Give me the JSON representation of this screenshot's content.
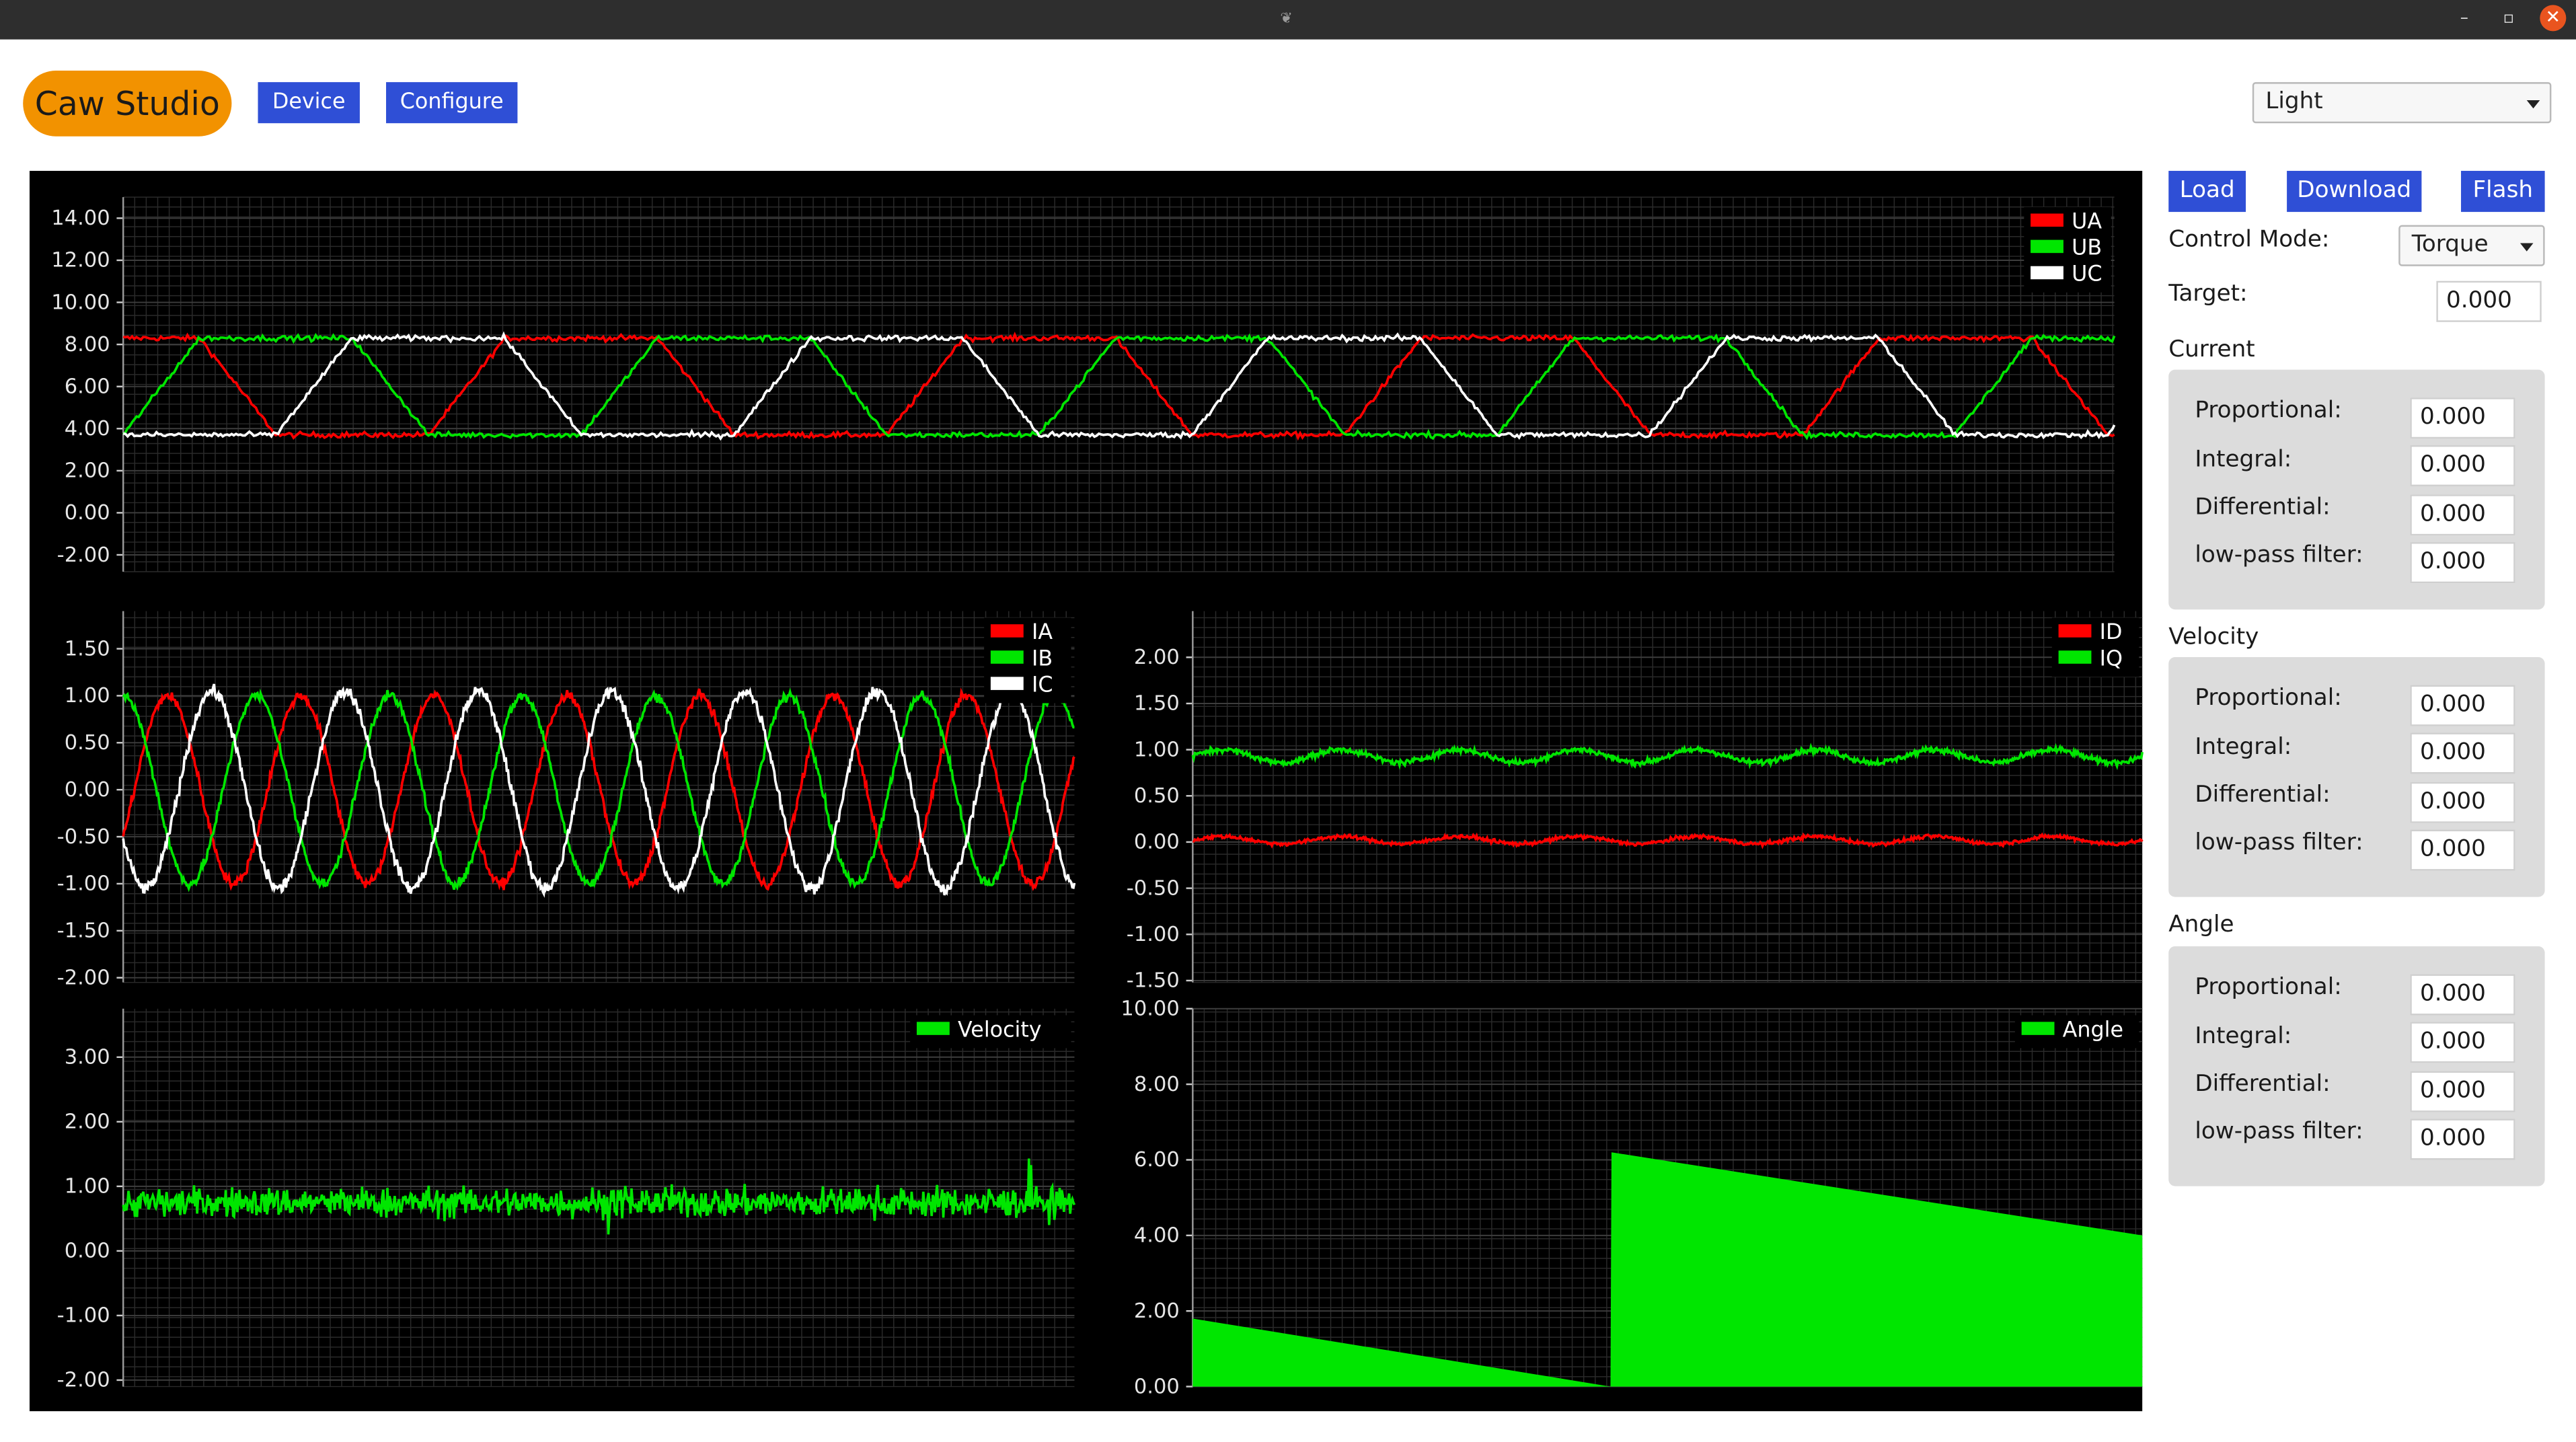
{
  "header": {
    "app_name": "Caw Studio",
    "device_label": "Device",
    "configure_label": "Configure",
    "theme_value": "Light"
  },
  "sidebar": {
    "load_label": "Load",
    "download_label": "Download",
    "flash_label": "Flash",
    "control_mode_label": "Control Mode:",
    "control_mode_value": "Torque",
    "target_label": "Target:",
    "target_value": "0.000",
    "groups": [
      {
        "title": "Current",
        "rows": [
          {
            "label": "Proportional:",
            "value": "0.000"
          },
          {
            "label": "Integral:",
            "value": "0.000"
          },
          {
            "label": "Differential:",
            "value": "0.000"
          },
          {
            "label": "low-pass filter:",
            "value": "0.000"
          }
        ]
      },
      {
        "title": "Velocity",
        "rows": [
          {
            "label": "Proportional:",
            "value": "0.000"
          },
          {
            "label": "Integral:",
            "value": "0.000"
          },
          {
            "label": "Differential:",
            "value": "0.000"
          },
          {
            "label": "low-pass filter:",
            "value": "0.000"
          }
        ]
      },
      {
        "title": "Angle",
        "rows": [
          {
            "label": "Proportional:",
            "value": "0.000"
          },
          {
            "label": "Integral:",
            "value": "0.000"
          },
          {
            "label": "Differential:",
            "value": "0.000"
          },
          {
            "label": "low-pass filter:",
            "value": "0.000"
          }
        ]
      }
    ]
  },
  "colors": {
    "red": "#ff0000",
    "green": "#00e600",
    "white": "#ffffff",
    "accent": "#2f4fd6",
    "logo": "#f29200"
  },
  "chart_data": [
    {
      "type": "line",
      "id": "voltage",
      "ylim": [
        -2.8,
        15
      ],
      "yticks": [
        "14.00",
        "12.00",
        "10.00",
        "8.00",
        "6.00",
        "4.00",
        "2.00",
        "0.00",
        "-2.00"
      ],
      "ytick_values": [
        14,
        12,
        10,
        8,
        6,
        4,
        2,
        0,
        -2
      ],
      "legend": [
        "UA",
        "UB",
        "UC"
      ],
      "legend_position": "top-right",
      "series": [
        {
          "name": "UA",
          "color": "#ff0000",
          "shape": "trapezoid",
          "low": 3.7,
          "high": 8.3,
          "period_fraction": 0.23,
          "phase": 0.333,
          "noise": 0.12
        },
        {
          "name": "UB",
          "color": "#00e600",
          "shape": "trapezoid",
          "low": 3.7,
          "high": 8.3,
          "period_fraction": 0.23,
          "phase": 0.0,
          "noise": 0.12
        },
        {
          "name": "UC",
          "color": "#ffffff",
          "shape": "trapezoid",
          "low": 3.7,
          "high": 8.3,
          "period_fraction": 0.23,
          "phase": 0.667,
          "noise": 0.12
        }
      ],
      "grid": true
    },
    {
      "type": "line",
      "id": "phase-current",
      "ylim": [
        -2.05,
        1.9
      ],
      "yticks": [
        "1.50",
        "1.00",
        "0.50",
        "0.00",
        "-0.50",
        "-1.00",
        "-1.50",
        "-2.00"
      ],
      "ytick_values": [
        1.5,
        1.0,
        0.5,
        0,
        -0.5,
        -1.0,
        -1.5,
        -2.0
      ],
      "legend": [
        "IA",
        "IB",
        "IC"
      ],
      "legend_position": "top-right",
      "series": [
        {
          "name": "IA",
          "color": "#ff0000",
          "shape": "sine",
          "amplitude": 1.0,
          "period_fraction": 0.14,
          "phase": 0.333,
          "noise": 0.05
        },
        {
          "name": "IB",
          "color": "#00e600",
          "shape": "sine",
          "amplitude": 1.0,
          "period_fraction": 0.14,
          "phase": 0.0,
          "noise": 0.05
        },
        {
          "name": "IC",
          "color": "#ffffff",
          "shape": "sine",
          "amplitude": 1.05,
          "period_fraction": 0.14,
          "phase": 0.667,
          "noise": 0.06
        }
      ],
      "grid": true
    },
    {
      "type": "line",
      "id": "dq-current",
      "ylim": [
        -1.52,
        2.5
      ],
      "yticks": [
        "2.00",
        "1.50",
        "1.00",
        "0.50",
        "0.00",
        "-0.50",
        "-1.00",
        "-1.50"
      ],
      "ytick_values": [
        2.0,
        1.5,
        1.0,
        0.5,
        0,
        -0.5,
        -1.0,
        -1.5
      ],
      "legend": [
        "ID",
        "IQ"
      ],
      "legend_position": "top-right",
      "series": [
        {
          "name": "ID",
          "color": "#ff0000",
          "shape": "flat",
          "level": 0.02,
          "wobble": 0.04,
          "noise": 0.02
        },
        {
          "name": "IQ",
          "color": "#00e600",
          "shape": "flat",
          "level": 0.93,
          "wobble": 0.07,
          "noise": 0.03
        }
      ],
      "grid": true
    },
    {
      "type": "line",
      "id": "velocity",
      "ylim": [
        -2.1,
        3.75
      ],
      "yticks": [
        "3.00",
        "2.00",
        "1.00",
        "0.00",
        "-1.00",
        "-2.00"
      ],
      "ytick_values": [
        3.0,
        2.0,
        1.0,
        0,
        -1.0,
        -2.0
      ],
      "legend": [
        "Velocity"
      ],
      "legend_position": "top-right",
      "series": [
        {
          "name": "Velocity",
          "color": "#00e600",
          "shape": "noise",
          "level": 0.75,
          "noise": 0.22
        }
      ],
      "grid": true
    },
    {
      "type": "area",
      "id": "angle",
      "ylim": [
        0,
        10
      ],
      "yticks": [
        "10.00",
        "8.00",
        "6.00",
        "4.00",
        "2.00",
        "0.00"
      ],
      "ytick_values": [
        10,
        8,
        6,
        4,
        2,
        0
      ],
      "legend": [
        "Angle"
      ],
      "legend_position": "top-right",
      "series": [
        {
          "name": "Angle",
          "color": "#00e600",
          "points": [
            [
              0,
              1.8
            ],
            [
              0.44,
              0.0
            ],
            [
              0.441,
              6.2
            ],
            [
              1.0,
              4.0
            ]
          ]
        }
      ],
      "grid": true
    }
  ]
}
